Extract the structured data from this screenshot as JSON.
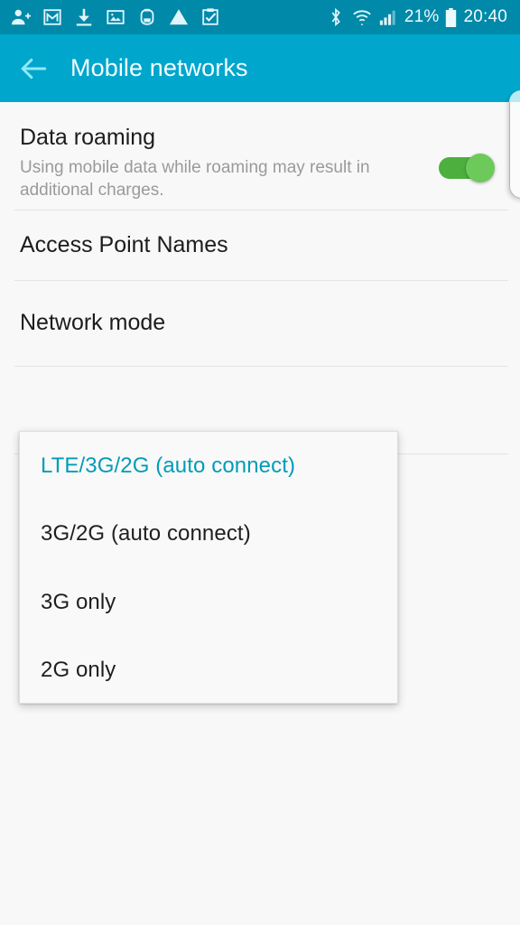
{
  "status_bar": {
    "background": "#0089a8",
    "left_icons": [
      {
        "name": "contact-add-icon",
        "label": "Contact added"
      },
      {
        "name": "gmail-icon",
        "label": "Gmail"
      },
      {
        "name": "download-icon",
        "label": "Download"
      },
      {
        "name": "image-icon",
        "label": "Screenshot captured"
      },
      {
        "name": "app-icon",
        "label": "App notification"
      },
      {
        "name": "warning-icon",
        "label": "Warning"
      },
      {
        "name": "clipboard-check-icon",
        "label": "Task complete"
      }
    ],
    "right_icons": [
      {
        "name": "bluetooth-icon",
        "label": "Bluetooth"
      },
      {
        "name": "wifi-icon",
        "label": "Wi-Fi"
      },
      {
        "name": "signal-icon",
        "label": "Mobile signal"
      }
    ],
    "battery_percent": "21%",
    "clock": "20:40"
  },
  "action_bar": {
    "background": "#00a6cc",
    "back_label": "Back",
    "title": "Mobile networks"
  },
  "settings": {
    "data_roaming": {
      "title": "Data roaming",
      "summary": "Using mobile data while roaming may result in additional charges.",
      "toggle_state": "on",
      "toggle_color": "#4caf3e"
    },
    "rows": [
      {
        "label": "Access Point Names"
      },
      {
        "label": "Network mode"
      }
    ]
  },
  "dropdown": {
    "accent": "#009cb8",
    "selected_index": 0,
    "options": [
      {
        "label": "LTE/3G/2G (auto connect)"
      },
      {
        "label": "3G/2G (auto connect)"
      },
      {
        "label": "3G only"
      },
      {
        "label": "2G only"
      }
    ]
  },
  "edge_panel": {
    "name": "edge-panel-handle"
  }
}
